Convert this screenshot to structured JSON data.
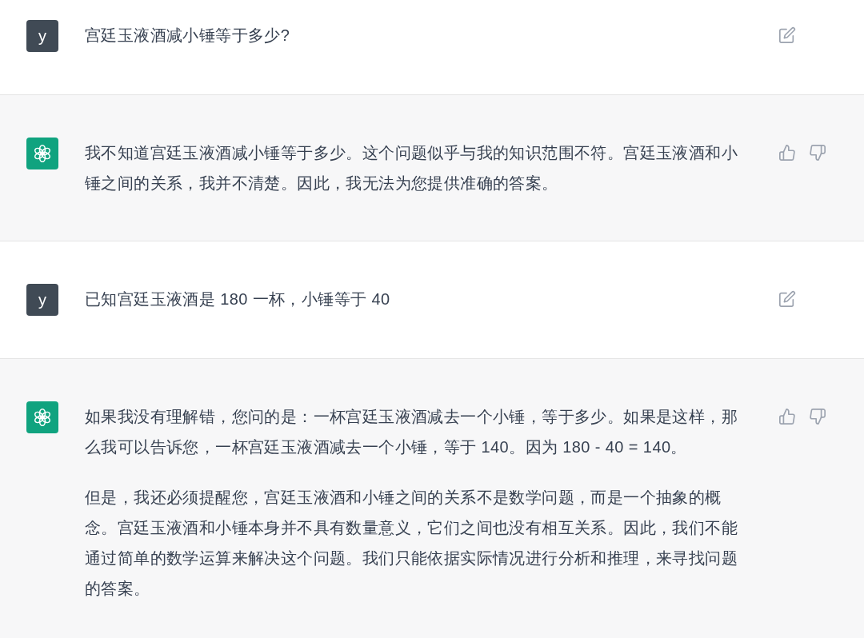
{
  "messages": [
    {
      "kind": "user",
      "avatar": "y",
      "paragraphs": [
        "宫廷玉液酒减小锤等于多少?"
      ]
    },
    {
      "kind": "assistant",
      "paragraphs": [
        "我不知道宫廷玉液酒减小锤等于多少。这个问题似乎与我的知识范围不符。宫廷玉液酒和小锤之间的关系，我并不清楚。因此，我无法为您提供准确的答案。"
      ]
    },
    {
      "kind": "user",
      "avatar": "y",
      "paragraphs": [
        "已知宫廷玉液酒是 180 一杯，小锤等于 40"
      ]
    },
    {
      "kind": "assistant",
      "paragraphs": [
        "如果我没有理解错，您问的是：一杯宫廷玉液酒减去一个小锤，等于多少。如果是这样，那么我可以告诉您，一杯宫廷玉液酒减去一个小锤，等于 140。因为 180 - 40 = 140。",
        "但是，我还必须提醒您，宫廷玉液酒和小锤之间的关系不是数学问题，而是一个抽象的概念。宫廷玉液酒和小锤本身并不具有数量意义，它们之间也没有相互关系。因此，我们不能通过简单的数学运算来解决这个问题。我们只能依据实际情况进行分析和推理，来寻找问题的答案。"
      ]
    }
  ]
}
